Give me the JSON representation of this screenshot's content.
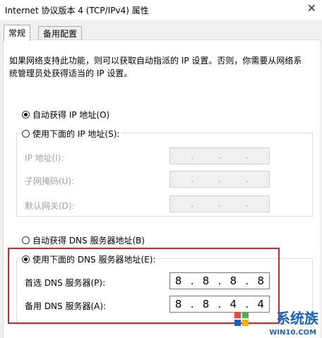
{
  "window": {
    "title": "Internet 协议版本 4 (TCP/IPv4) 属性",
    "close_glyph": "✕"
  },
  "tabs": [
    {
      "label": "常规",
      "active": true
    },
    {
      "label": "备用配置",
      "active": false
    }
  ],
  "description": "如果网络支持此功能，则可以获取自动指派的 IP 设置。否则，你需要从网络系统管理员处获得适当的 IP 设置。",
  "ip": {
    "auto_label": "自动获得 IP 地址(O)",
    "manual_label": "使用下面的 IP 地址(S):",
    "selected": "auto",
    "fields": [
      {
        "label": "IP 地址(I):",
        "value": [
          "",
          "",
          "",
          ""
        ]
      },
      {
        "label": "子网掩码(U):",
        "value": [
          "",
          "",
          "",
          ""
        ]
      },
      {
        "label": "默认网关(D):",
        "value": [
          "",
          "",
          "",
          ""
        ]
      }
    ]
  },
  "dns": {
    "auto_label": "自动获得 DNS 服务器地址(B)",
    "manual_label": "使用下面的 DNS 服务器地址(E):",
    "selected": "manual",
    "fields": [
      {
        "label": "首选 DNS 服务器(P):",
        "value": [
          "8",
          "8",
          "8",
          "8"
        ]
      },
      {
        "label": "备用 DNS 服务器(A):",
        "value": [
          "8",
          "8",
          "4",
          "4"
        ]
      }
    ]
  },
  "watermark": {
    "logo_text": "系统族",
    "url": "WIN10.COM"
  },
  "colors": {
    "highlight": "#d9232a",
    "watermark": "#1d61b5"
  }
}
